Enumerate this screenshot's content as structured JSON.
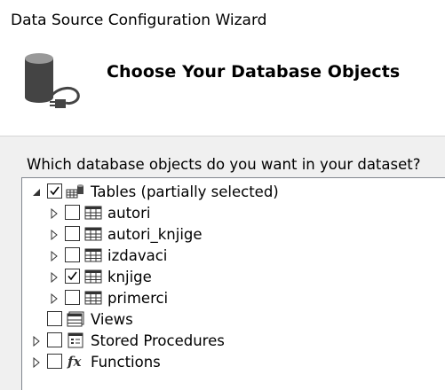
{
  "window": {
    "title": "Data Source Configuration Wizard"
  },
  "header": {
    "title": "Choose Your Database Objects",
    "icon": "database-connection-icon"
  },
  "question": "Which database objects do you want in your dataset?",
  "tree": {
    "tables": {
      "label": "Tables (partially selected)",
      "expanded": true,
      "checked": "partial",
      "children": [
        {
          "label": "autori",
          "checked": false
        },
        {
          "label": "autori_knjige",
          "checked": false
        },
        {
          "label": "izdavaci",
          "checked": false
        },
        {
          "label": "knjige",
          "checked": true
        },
        {
          "label": "primerci",
          "checked": false
        }
      ]
    },
    "views": {
      "label": "Views",
      "checked": false
    },
    "stored_procedures": {
      "label": "Stored Procedures",
      "checked": false
    },
    "functions": {
      "label": "Functions",
      "checked": false
    }
  }
}
